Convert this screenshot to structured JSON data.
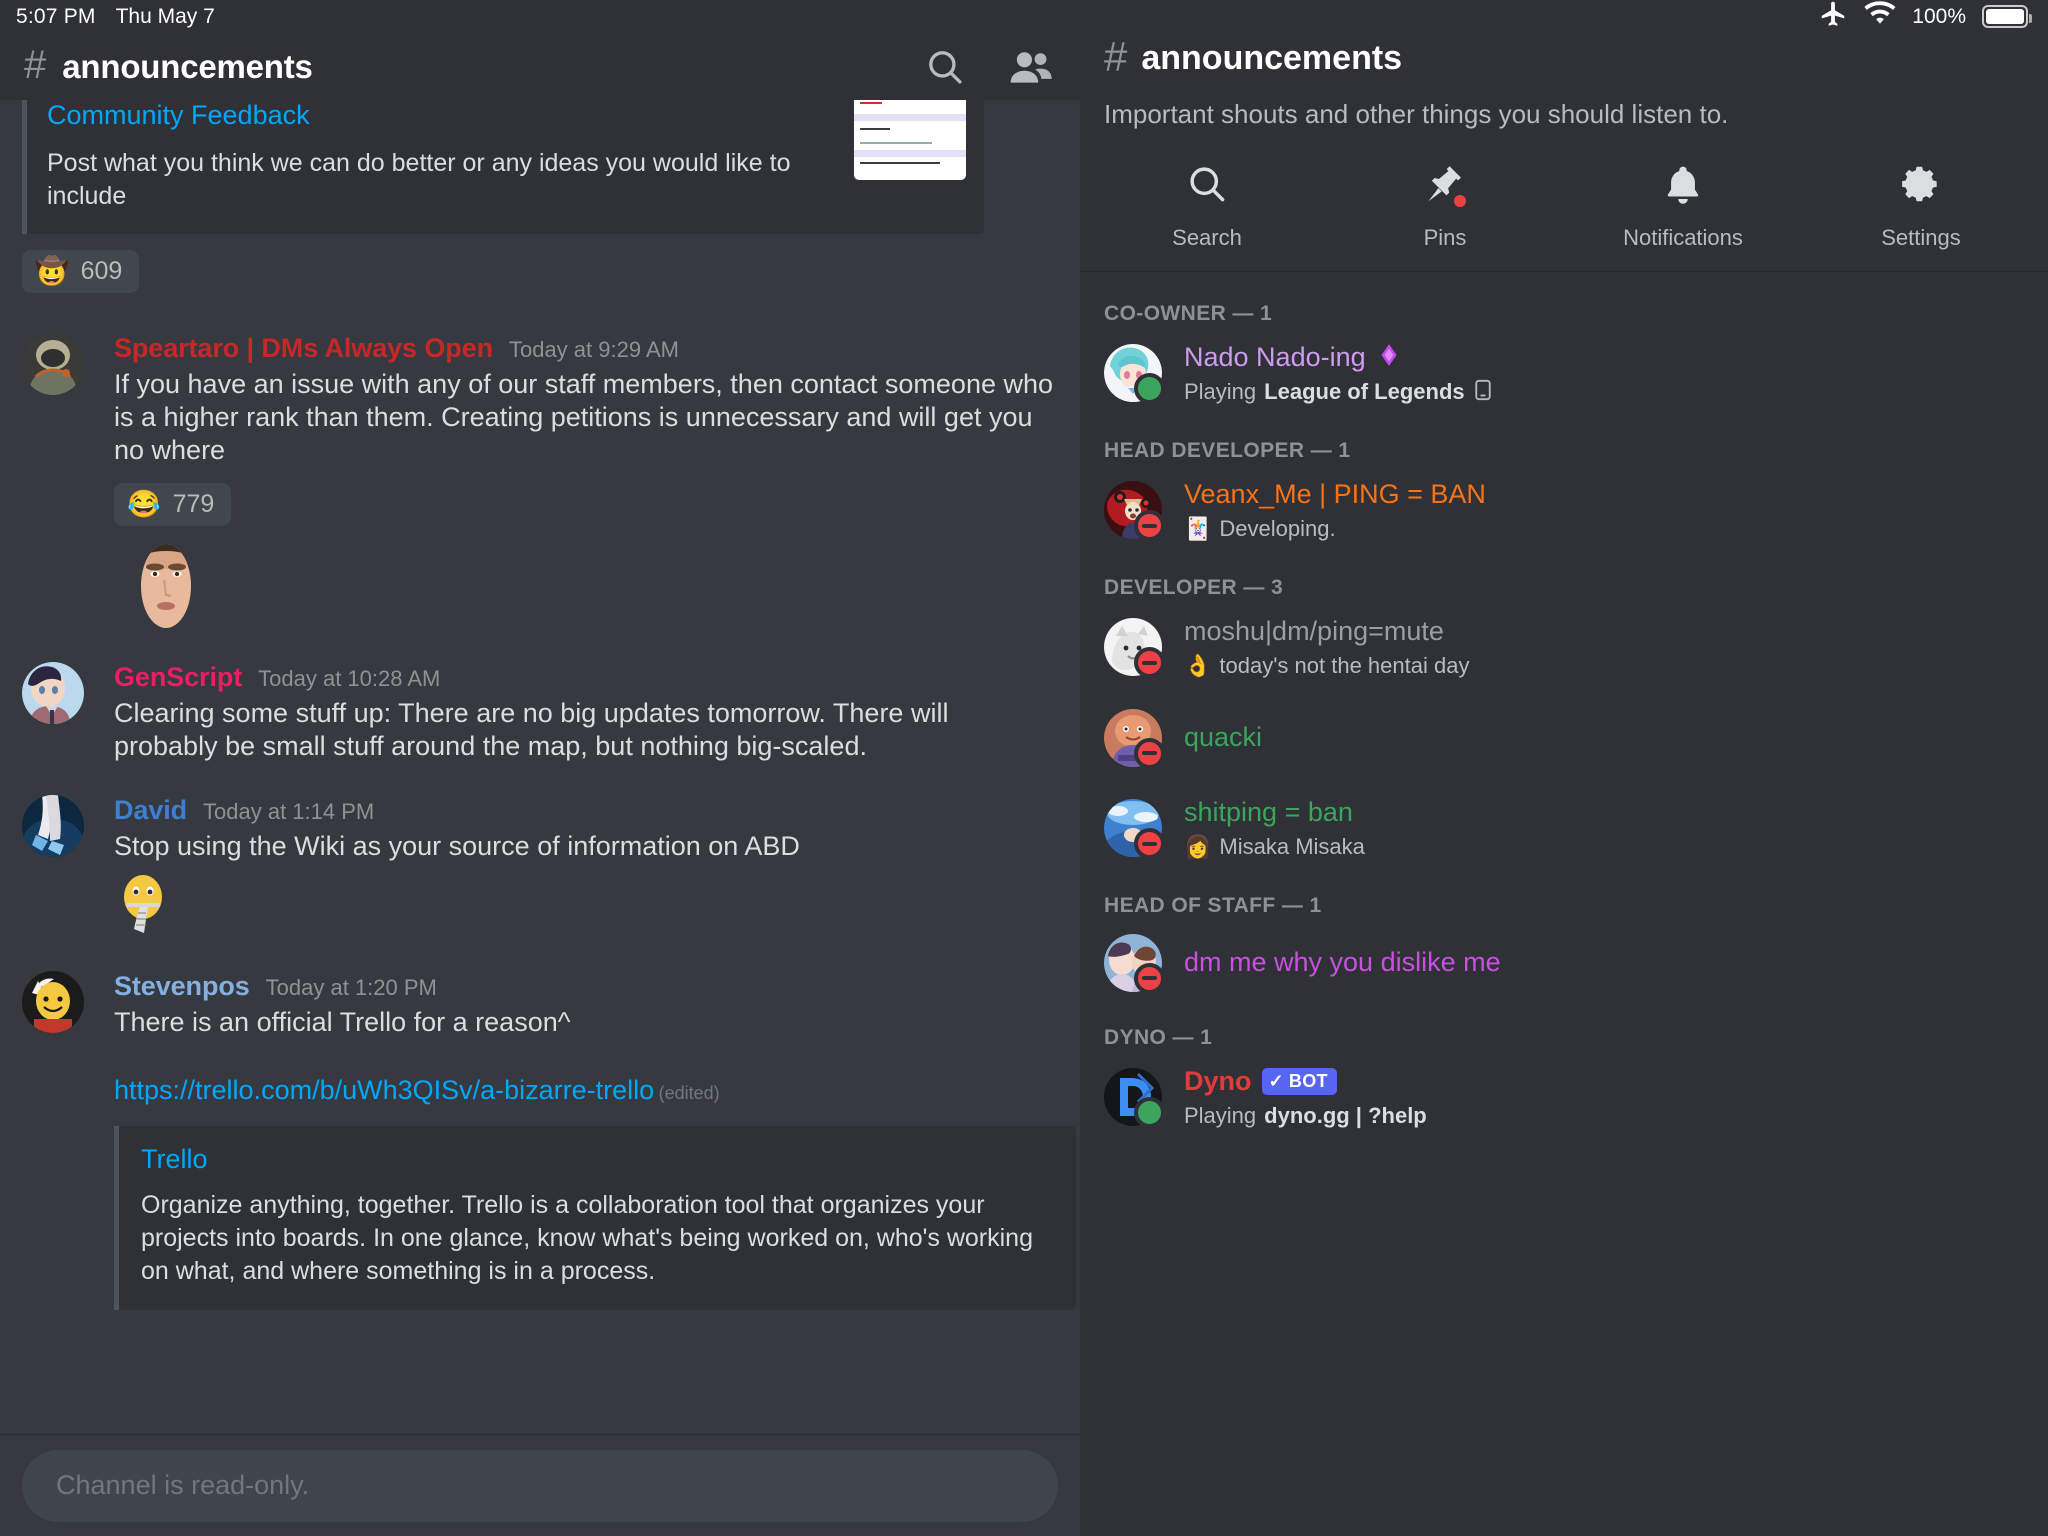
{
  "status_bar": {
    "time": "5:07 PM",
    "date": "Thu May 7",
    "battery_percent": "100%",
    "airplane_icon": "airplane-mode-icon",
    "wifi_icon": "wifi-icon",
    "battery_icon": "battery-full-icon"
  },
  "chat_header": {
    "hash": "#",
    "channel_name": "announcements",
    "search_icon": "search-icon",
    "members_icon": "members-icon"
  },
  "pinned_embed": {
    "title": "Community Feedback",
    "description": "Post what you think we can do better or any ideas you would like to include",
    "reaction_emoji": "🤠",
    "reaction_count": "609"
  },
  "messages": [
    {
      "author": "Speartaro | DMs Always Open",
      "author_color": "#c62828",
      "timestamp": "Today at 9:29 AM",
      "text": "If you have an issue with any of our staff members, then contact someone who is a higher rank than them. Creating petitions is unnecessary and will get you no where",
      "reaction_emoji": "😂",
      "reaction_count": "779"
    },
    {
      "author": "GenScript",
      "author_color": "#e91e63",
      "timestamp": "Today at 10:28 AM",
      "text": "Clearing some stuff up: There are no big updates tomorrow. There will probably be small stuff around the map, but nothing big-scaled."
    },
    {
      "author": "David",
      "author_color": "#3f7fd0",
      "timestamp": "Today at 1:14 PM",
      "text": "Stop using the Wiki as your source of information on ABD"
    },
    {
      "author": "Stevenpos",
      "author_color": "#83b0e0",
      "timestamp": "Today at 1:20 PM",
      "text": "There is an official Trello for a reason^",
      "link": "https://trello.com/b/uWh3QISv/a-bizarre-trello",
      "edited_label": "(edited)",
      "embed": {
        "title": "Trello",
        "description": "Organize anything, together. Trello is a collaboration tool that organizes your projects into boards. In one glance, know what's being worked on, who's working on what, and where something is in a process."
      }
    }
  ],
  "composer": {
    "placeholder": "Channel is read-only."
  },
  "sidebar": {
    "hash": "#",
    "channel_name": "announcements",
    "topic": "Important shouts and other things you should listen to.",
    "actions": [
      {
        "icon": "search-icon",
        "label": "Search"
      },
      {
        "icon": "pin-icon",
        "label": "Pins",
        "badge": true
      },
      {
        "icon": "bell-icon",
        "label": "Notifications"
      },
      {
        "icon": "gear-icon",
        "label": "Settings"
      }
    ],
    "groups": [
      {
        "title": "CO-OWNER — 1",
        "members": [
          {
            "name": "Nado Nado-ing",
            "name_color": "#cf9bf0",
            "status": "online",
            "badge_icon": "nitro-diamond-icon",
            "activity_prefix": "Playing ",
            "activity_bold": "League of Legends",
            "activity_suffix": "",
            "activity_trailing_icon": "📱",
            "avatar_kind": "anime-blue-hair"
          }
        ]
      },
      {
        "title": "HEAD DEVELOPER — 1",
        "members": [
          {
            "name": "Veanx_Me | PING = BAN",
            "name_color": "#f97316",
            "status": "dnd",
            "activity_emoji": "🃏",
            "activity_prefix": "",
            "activity_bold": "",
            "activity_suffix": "Developing.",
            "avatar_kind": "red-anime"
          }
        ]
      },
      {
        "title": "DEVELOPER — 3",
        "members": [
          {
            "name": "moshu|dm/ping=mute",
            "name_color": "#9a9ea5",
            "status": "dnd",
            "activity_emoji": "👌",
            "activity_prefix": "",
            "activity_bold": "",
            "activity_suffix": "today's not the hentai day",
            "avatar_kind": "white-sketch"
          },
          {
            "name": "quacki",
            "name_color": "#3ba55d",
            "status": "dnd",
            "activity_emoji": "",
            "activity_prefix": "",
            "activity_bold": "",
            "activity_suffix": "",
            "avatar_kind": "patrick"
          },
          {
            "name": "shitping = ban",
            "name_color": "#3ba55d",
            "status": "dnd",
            "activity_emoji": "👩",
            "activity_prefix": "",
            "activity_bold": "",
            "activity_suffix": "Misaka Misaka",
            "avatar_kind": "blue-sky"
          }
        ]
      },
      {
        "title": "HEAD OF STAFF — 1",
        "members": [
          {
            "name": "dm me why you dislike me",
            "name_color": "#c850e0",
            "status": "dnd",
            "activity_emoji": "",
            "activity_prefix": "",
            "activity_bold": "",
            "activity_suffix": "",
            "avatar_kind": "couple"
          }
        ]
      },
      {
        "title": "DYNO — 1",
        "members": [
          {
            "name": "Dyno",
            "name_color": "#e03c3c",
            "status": "online",
            "bot_label": "BOT",
            "bot_check": "✓",
            "activity_prefix": "Playing ",
            "activity_bold": "dyno.gg | ?help",
            "activity_suffix": "",
            "avatar_kind": "dyno"
          }
        ]
      }
    ]
  },
  "colors": {
    "chat_bg": "#36393f",
    "side_bg": "#2f3136",
    "header_bg": "#2f3136",
    "link": "#00a8fc",
    "muted": "#8e9297",
    "text": "#dcddde"
  }
}
